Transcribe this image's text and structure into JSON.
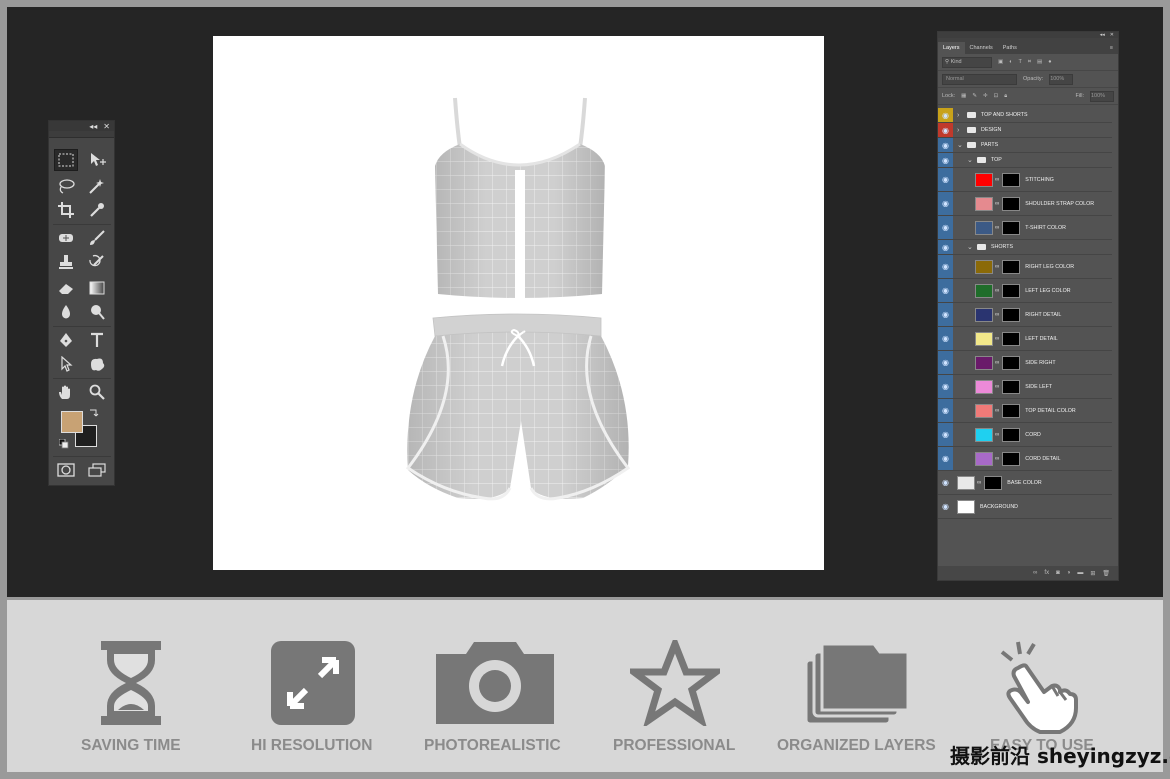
{
  "toolbar": {
    "collapse_glyph": "◂◂",
    "close_glyph": "✕"
  },
  "layers_panel": {
    "tabs": [
      "Layers",
      "Channels",
      "Paths"
    ],
    "filter_kind": "Kind",
    "blend_mode": "Normal",
    "opacity_label": "Opacity:",
    "opacity_value": "100%",
    "lock_label": "Lock:",
    "fill_label": "Fill:",
    "fill_value": "100%",
    "layers": [
      {
        "name": "TOP AND SHORTS",
        "kind": "group",
        "indent": 0,
        "tag": "#c8a21a"
      },
      {
        "name": "DESIGN",
        "kind": "group",
        "indent": 0,
        "tag": "#c0392b"
      },
      {
        "name": "PARTS",
        "kind": "group-open",
        "indent": 0,
        "tag": "#3d6d9e"
      },
      {
        "name": "TOP",
        "kind": "group-open",
        "indent": 1,
        "tag": "#3d6d9e"
      },
      {
        "name": "STITCHING",
        "kind": "fill",
        "color": "#ff0000",
        "indent": 2
      },
      {
        "name": "SHOULDER STRAP COLOR",
        "kind": "fill",
        "color": "#e58a8f",
        "indent": 2
      },
      {
        "name": "T-SHIRT COLOR",
        "kind": "fill",
        "color": "#3c5a86",
        "indent": 2
      },
      {
        "name": "SHORTS",
        "kind": "group-open",
        "indent": 1,
        "tag": "#3d6d9e"
      },
      {
        "name": "RIGHT LEG COLOR",
        "kind": "fill",
        "color": "#8b6a08",
        "indent": 2
      },
      {
        "name": "LEFT LEG COLOR",
        "kind": "fill",
        "color": "#1f6d2a",
        "indent": 2
      },
      {
        "name": "RIGHT DETAIL",
        "kind": "fill",
        "color": "#2a3470",
        "indent": 2
      },
      {
        "name": "LEFT DETAIL",
        "kind": "fill",
        "color": "#f2e88a",
        "indent": 2
      },
      {
        "name": "SIDE RIGHT",
        "kind": "fill",
        "color": "#6a1a6a",
        "indent": 2
      },
      {
        "name": "SIDE LEFT",
        "kind": "fill",
        "color": "#ec8ad8",
        "indent": 2
      },
      {
        "name": "TOP DETAIL COLOR",
        "kind": "fill",
        "color": "#f07a78",
        "indent": 2
      },
      {
        "name": "CORD",
        "kind": "fill",
        "color": "#1fd0f0",
        "indent": 2
      },
      {
        "name": "CORD DETAIL",
        "kind": "fill",
        "color": "#a86ac8",
        "indent": 2
      },
      {
        "name": "BASE COLOR",
        "kind": "fill",
        "color": "#e8e8e8",
        "indent": 0
      },
      {
        "name": "BACKGROUND",
        "kind": "plain",
        "color": "#ffffff",
        "indent": 0
      }
    ]
  },
  "features": [
    {
      "label": "SAVING TIME",
      "icon": "hourglass-icon"
    },
    {
      "label": "HI RESOLUTION",
      "icon": "expand-arrows-icon"
    },
    {
      "label": "PHOTOREALISTIC",
      "icon": "camera-icon"
    },
    {
      "label": "PROFESSIONAL",
      "icon": "star-icon"
    },
    {
      "label": "ORGANIZED LAYERS",
      "icon": "folders-icon"
    },
    {
      "label": "EASY TO USE",
      "icon": "tap-hand-icon"
    }
  ],
  "watermark": "摄影前沿 sheyingzyz.com",
  "colors": {
    "foreground": "#c8a274",
    "background": "#1f1f1f",
    "workspace": "#252525",
    "feature_icon": "#777777"
  }
}
